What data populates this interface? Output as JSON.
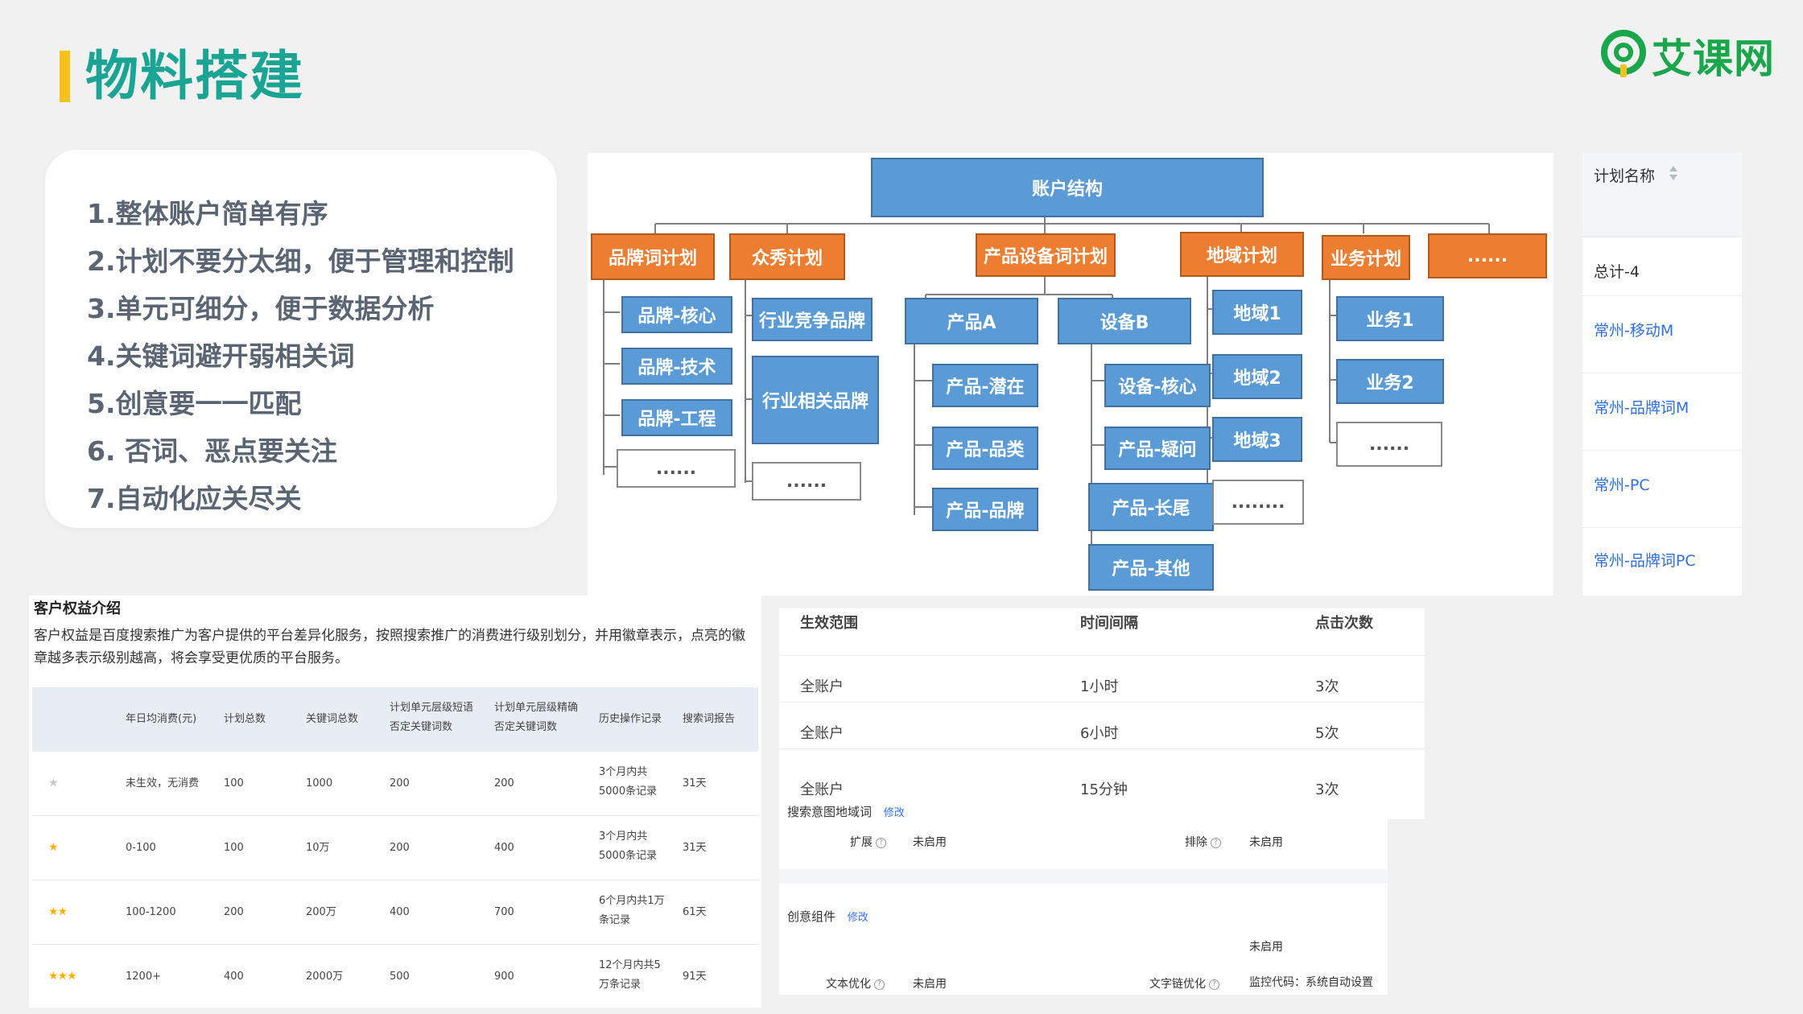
{
  "title": "物料搭建",
  "logo": {
    "text": "艾课网",
    "icon": "qa-bubble-icon",
    "color": "#1aa64a"
  },
  "colors": {
    "accent": "#1aa493",
    "bar": "#f6c21b",
    "node_blue": "#5b9bd5",
    "node_orange": "#ed7d31",
    "link": "#3370ff"
  },
  "points": [
    "1.整体账户简单有序",
    "2.计划不要分太细，便于管理和控制",
    "3.单元可细分，便于数据分析",
    "4.关键词避开弱相关词",
    "5.创意要一一匹配",
    "6. 否词、恶点要关注",
    "7.自动化应关尽关"
  ],
  "org": {
    "root": "账户结构",
    "plans": [
      "品牌词计划",
      "众秀计划",
      "产品设备词计划",
      "地域计划",
      "业务计划",
      "......"
    ],
    "brand": [
      "品牌-核心",
      "品牌-技术",
      "品牌-工程",
      "......"
    ],
    "show": [
      "行业竞争品牌",
      "行业相关品牌",
      "......"
    ],
    "product_a": "产品A",
    "product_a_children": [
      "产品-潜在",
      "产品-品类",
      "产品-品牌"
    ],
    "device_b": "设备B",
    "device_b_children": [
      "设备-核心",
      "产品-疑问",
      "产品-长尾",
      "产品-其他"
    ],
    "region": [
      "地域1",
      "地域2",
      "地域3",
      "........"
    ],
    "business": [
      "业务1",
      "业务2",
      "......"
    ]
  },
  "plan_table": {
    "header": "计划名称",
    "total": "总计-4",
    "rows": [
      "常州-移动M",
      "常州-品牌词M",
      "常州-PC",
      "常州-品牌词PC"
    ]
  },
  "rights": {
    "title": "客户权益介绍",
    "description": "客户权益是百度搜索推广为客户提供的平台差异化服务，按照搜索推广的消费进行级别划分，并用徽章表示，点亮的徽章越多表示级别越高，将会享受更优质的平台服务。",
    "headers": [
      "年日均消费(元)",
      "计划总数",
      "关键词总数",
      "计划单元层级短语否定关键词数",
      "计划单元层级精确否定关键词数",
      "历史操作记录",
      "搜索词报告"
    ],
    "rows": [
      {
        "stars": 1,
        "lit": false,
        "cells": [
          "未生效，无消费",
          "100",
          "1000",
          "200",
          "200",
          "3个月内共5000条记录",
          "31天"
        ]
      },
      {
        "stars": 1,
        "lit": true,
        "cells": [
          "0-100",
          "100",
          "10万",
          "200",
          "400",
          "3个月内共5000条记录",
          "31天"
        ]
      },
      {
        "stars": 2,
        "lit": true,
        "cells": [
          "100-1200",
          "200",
          "200万",
          "400",
          "700",
          "6个月内共1万条记录",
          "61天"
        ]
      },
      {
        "stars": 3,
        "lit": true,
        "cells": [
          "1200+",
          "400",
          "2000万",
          "500",
          "900",
          "12个月内共5万条记录",
          "91天"
        ]
      }
    ]
  },
  "frequency": {
    "headers": [
      "生效范围",
      "时间间隔",
      "点击次数"
    ],
    "rows": [
      [
        "全账户",
        "1小时",
        "3次"
      ],
      [
        "全账户",
        "6小时",
        "5次"
      ],
      [
        "全账户",
        "15分钟",
        "3次"
      ]
    ]
  },
  "settings": {
    "geo_label": "搜索意图地域词",
    "edit": "修改",
    "expand_label": "扩展",
    "expand_value": "未启用",
    "exclude_label": "排除",
    "exclude_value": "未启用",
    "creative_label": "创意组件",
    "text_opt_label": "文本优化",
    "text_opt_value": "未启用",
    "chain_label": "文字链优化",
    "chain_value": "未启用",
    "monitor": "监控代码：系统自动设置"
  }
}
